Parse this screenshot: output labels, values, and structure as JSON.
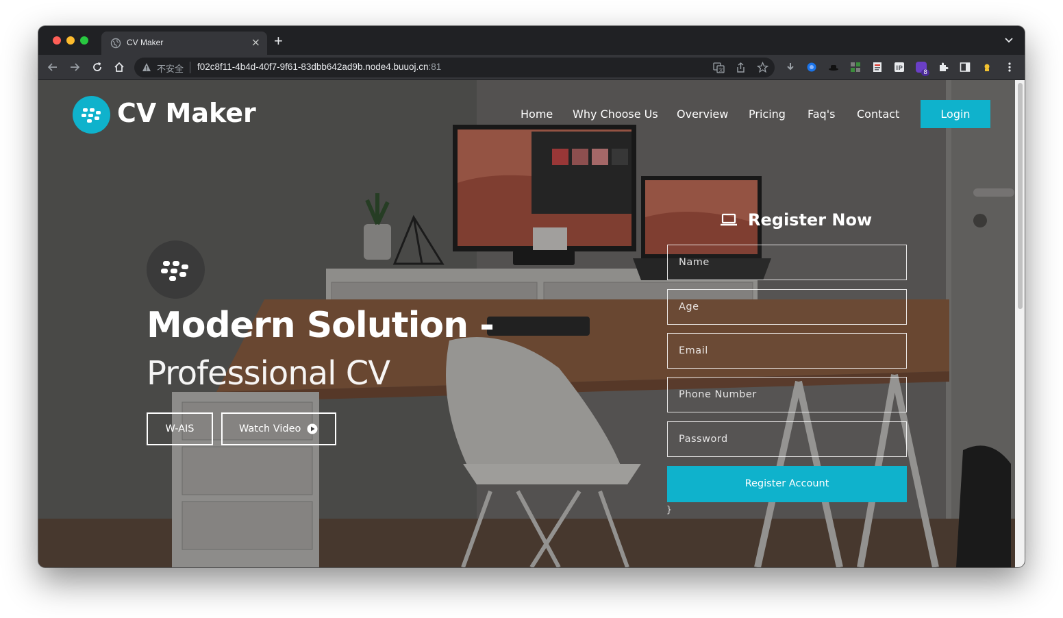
{
  "browser": {
    "tab_title": "CV Maker",
    "tab_close": "×",
    "new_tab": "+",
    "security_label": "不安全",
    "url_host": "f02c8f11-4b4d-40f7-9f61-83dbb642ad9b.node4.buuoj.cn",
    "url_port": ":81",
    "extension_badge": "8"
  },
  "header": {
    "logo_text": "CV Maker",
    "nav": [
      "Home",
      "Why Choose Us",
      "Overview",
      "Pricing",
      "Faq's",
      "Contact"
    ],
    "login_label": "Login"
  },
  "hero": {
    "title": "Modern Solution -",
    "subtitle": "Professional CV",
    "primary_button": "W-AIS",
    "video_button": "Watch Video"
  },
  "register": {
    "title": "Register Now",
    "fields": [
      "Name",
      "Age",
      "Email",
      "Phone Number",
      "Password"
    ],
    "submit_label": "Register Account",
    "stray_text": "}"
  },
  "colors": {
    "accent": "#0fb2cc",
    "chrome_bg": "#202124",
    "toolbar_bg": "#35363a"
  }
}
